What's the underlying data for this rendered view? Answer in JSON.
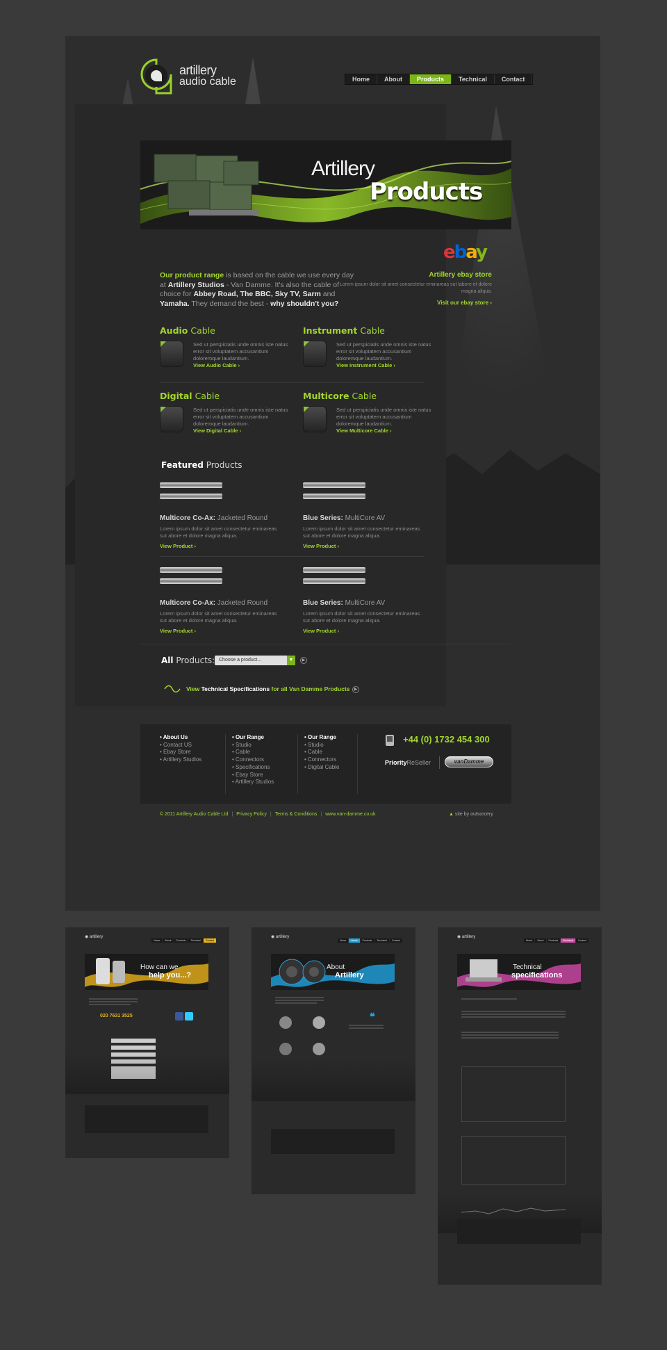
{
  "nav": {
    "items": [
      "Home",
      "About",
      "Products",
      "Technical",
      "Contact"
    ],
    "active": "Products"
  },
  "logo": {
    "line1": "artillery",
    "line2": "audio cable"
  },
  "banner": {
    "title1": "Artillery",
    "title2": "Products"
  },
  "intro": {
    "lead": "Our product range",
    "t1": " is based on the cable we use every day at ",
    "studio": "Artillery Studios",
    "t2": " - Van Damme. It's also the cable of choice for ",
    "clients": "Abbey Road, The BBC, Sky TV, Sarm",
    "and": " and ",
    "yamaha": "Yamaha.",
    "t3": " They demand the best - ",
    "why": "why shouldn't you?"
  },
  "ebay": {
    "logo": "ebay",
    "title": "Artillery ebay store",
    "text": "Lorem ipsum dolor sit amet consectetur eminareas sut labore et dolore magna aliqua.",
    "link": "Visit our ebay store"
  },
  "categories": [
    {
      "bold": "Audio",
      "rest": " Cable",
      "text": "Sed ut perspiciatis unde omnis iste natus error sit voluptatem accusantium doloremque laudantium.",
      "link": "View Audio Cable"
    },
    {
      "bold": "Instrument",
      "rest": " Cable",
      "text": "Sed ut perspiciatis unde omnis iste natus error sit voluptatem accusantium doloremque laudantium.",
      "link": "View Instrument Cable"
    },
    {
      "bold": "Digital",
      "rest": " Cable",
      "text": "Sed ut perspiciatis unde omnis iste natus error sit voluptatem accusantium doloremque laudantium.",
      "link": "View Digital Cable"
    },
    {
      "bold": "Multicore",
      "rest": " Cable",
      "text": "Sed ut perspiciatis unde omnis iste natus error sit voluptatem accusantium doloremque laudantium.",
      "link": "View Multicore Cable"
    }
  ],
  "featured": {
    "bold": "Featured",
    "rest": " Products"
  },
  "products": [
    {
      "bold": "Multicore Co-Ax:",
      "rest": " Jacketed Round",
      "text": "Lorem ipsum dolor sit amet consectetur eminareas sut abore et dolore magna aliqua.",
      "link": "View Product"
    },
    {
      "bold": "Blue Series:",
      "rest": " MultiCore AV",
      "text": "Lorem ipsum dolor sit amet consectetur eminareas sut abore et dolore magna aliqua.",
      "link": "View Product"
    },
    {
      "bold": "Multicore Co-Ax:",
      "rest": " Jacketed Round",
      "text": "Lorem ipsum dolor sit amet consectetur eminareas sut abore et dolore magna aliqua.",
      "link": "View Product"
    },
    {
      "bold": "Blue Series:",
      "rest": " MultiCore AV",
      "text": "Lorem ipsum dolor sit amet consectetur eminareas sut abore et dolore magna aliqua.",
      "link": "View Product"
    }
  ],
  "all_products": {
    "bold": "All",
    "rest": " Products:",
    "placeholder": "Choose a product..."
  },
  "spec_link": {
    "t1": "View ",
    "bold": "Technical Specifications",
    "t2": " for all Van Damme Products"
  },
  "footer": {
    "col1": {
      "heading": "About Us",
      "items": [
        "Contact US",
        "Ebay Store",
        "Artillery Studios"
      ]
    },
    "col2": {
      "heading": "Our Range",
      "items": [
        "Studio",
        "Cable",
        "Connectors",
        "Specifications",
        "Ebay Store",
        "Artillery Studios"
      ]
    },
    "col3": {
      "heading": "Our Range",
      "items": [
        "Studio",
        "Cable",
        "Connectors",
        "Digital Cable"
      ]
    },
    "phone": "+44 (0) 1732 454 300",
    "reseller_bold": "Priority",
    "reseller_rest": "ReSeller",
    "badge": "vanDamme"
  },
  "bottom": {
    "copyright": "© 2011 Artillery Audio Cable Ltd",
    "privacy": "Privacy Policy",
    "terms": "Terms & Conditions",
    "site": "www.van-damme.co.uk",
    "siteby": "site by outsorcery"
  },
  "thumbs": [
    {
      "title1": "How can we",
      "title2": "help you...?",
      "accent": "#e8b21a",
      "phone": "020 7631 3525"
    },
    {
      "title1": "About",
      "title2": "Artillery",
      "accent": "#1fa3e0"
    },
    {
      "title1": "Technical",
      "title2": "specifications",
      "accent": "#d24aa9"
    }
  ],
  "colors": {
    "accent": "#a3d62e",
    "bg": "#3a3a3a",
    "page": "#2d2d2d"
  }
}
